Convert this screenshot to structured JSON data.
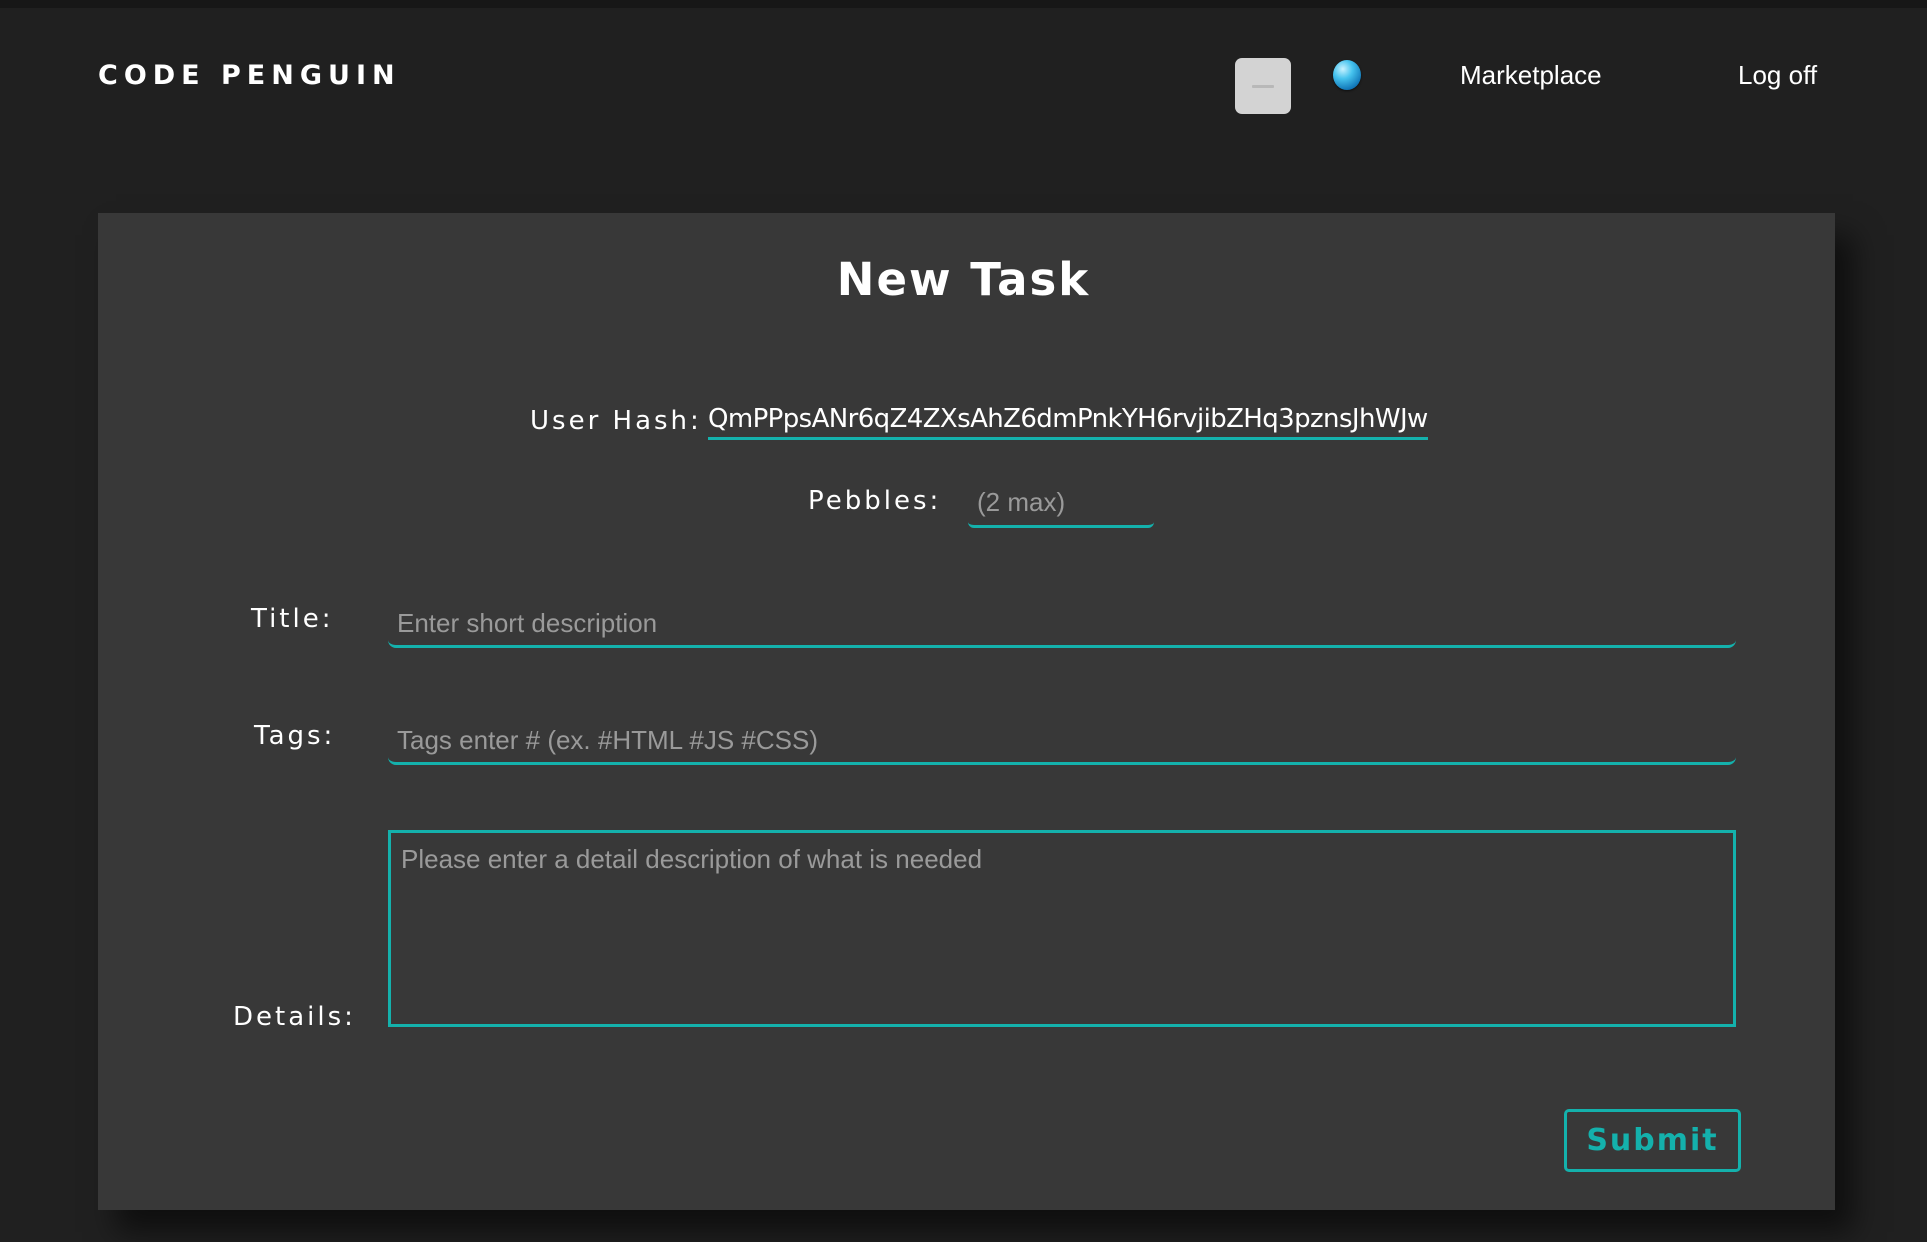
{
  "app": {
    "logo": "CODE PENGUIN"
  },
  "header": {
    "avatar_icon": "user-avatar-icon",
    "pebble_icon": "pebble-icon",
    "nav": {
      "marketplace": "Marketplace",
      "logoff": "Log off"
    }
  },
  "form": {
    "title": "New Task",
    "user_hash": {
      "label": "User Hash:",
      "value": "QmPPpsANr6qZ4ZXsAhZ6dmPnkYH6rvjibZHq3pznsJhWJw"
    },
    "pebbles": {
      "label": "Pebbles:",
      "value": "",
      "placeholder": "(2 max)"
    },
    "task_title": {
      "label": "Title:",
      "value": "",
      "placeholder": "Enter short description"
    },
    "tags": {
      "label": "Tags:",
      "value": "",
      "placeholder": "Tags enter # (ex. #HTML #JS #CSS)"
    },
    "details": {
      "label": "Details:",
      "value": "",
      "placeholder": "Please enter a detail description of what is needed"
    },
    "submit_label": "Submit"
  },
  "colors": {
    "accent": "#14b1ac",
    "page_background": "#202020",
    "card_background": "#383838",
    "placeholder_text": "#9a9a9a"
  }
}
